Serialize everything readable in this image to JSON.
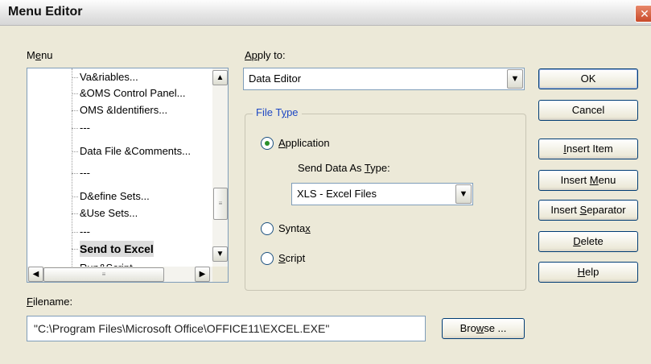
{
  "window": {
    "title": "Menu Editor",
    "close_glyph": "✕"
  },
  "menu_label_parts": [
    "M",
    "e",
    "nu"
  ],
  "tree": {
    "items": [
      "Va&riables...",
      "&OMS Control Panel...",
      "OMS &Identifiers...",
      "---",
      "Data File &Comments...",
      "---",
      "D&efine Sets...",
      "&Use Sets...",
      "---",
      "Send to Excel",
      "Run&Script..."
    ],
    "selected_index": 9
  },
  "apply_to": {
    "label_parts": [
      "A",
      "p",
      "ply to:"
    ],
    "value": "Data Editor"
  },
  "file_type": {
    "title_parts": [
      "File T",
      "y",
      "pe"
    ],
    "application": {
      "label_parts": [
        "",
        "A",
        "pplication"
      ],
      "checked": true
    },
    "send_as": {
      "label_parts": [
        "Send Data As ",
        "T",
        "ype:"
      ],
      "value": "XLS - Excel Files"
    },
    "syntax": {
      "label_parts": [
        "Synta",
        "x",
        ""
      ],
      "checked": false
    },
    "script": {
      "label_parts": [
        "",
        "S",
        "cript"
      ],
      "checked": false
    }
  },
  "buttons": {
    "ok": {
      "label_parts": [
        "OK",
        "",
        ""
      ]
    },
    "cancel": {
      "label_parts": [
        "Cancel",
        "",
        ""
      ]
    },
    "insert_item": {
      "label_parts": [
        "",
        "I",
        "nsert Item"
      ]
    },
    "insert_menu": {
      "label_parts": [
        "Insert ",
        "M",
        "enu"
      ]
    },
    "insert_separator": {
      "label_parts": [
        "Insert ",
        "S",
        "eparator"
      ]
    },
    "delete": {
      "label_parts": [
        "",
        "D",
        "elete"
      ]
    },
    "help": {
      "label_parts": [
        "",
        "H",
        "elp"
      ]
    }
  },
  "filename": {
    "label_parts": [
      "",
      "F",
      "ilename:"
    ],
    "value": "\"C:\\Program Files\\Microsoft Office\\OFFICE11\\EXCEL.EXE\""
  },
  "browse": {
    "label_parts": [
      "Bro",
      "w",
      "se ..."
    ]
  },
  "icons": {
    "scroll_up": "▲",
    "scroll_down": "▼",
    "scroll_left": "◀",
    "scroll_right": "▶",
    "dropdown": "▼",
    "grip": "≡"
  },
  "colors": {
    "group_title": "#1f49c4",
    "radio_dot": "#2a8f2a",
    "button_border": "#003c74"
  }
}
